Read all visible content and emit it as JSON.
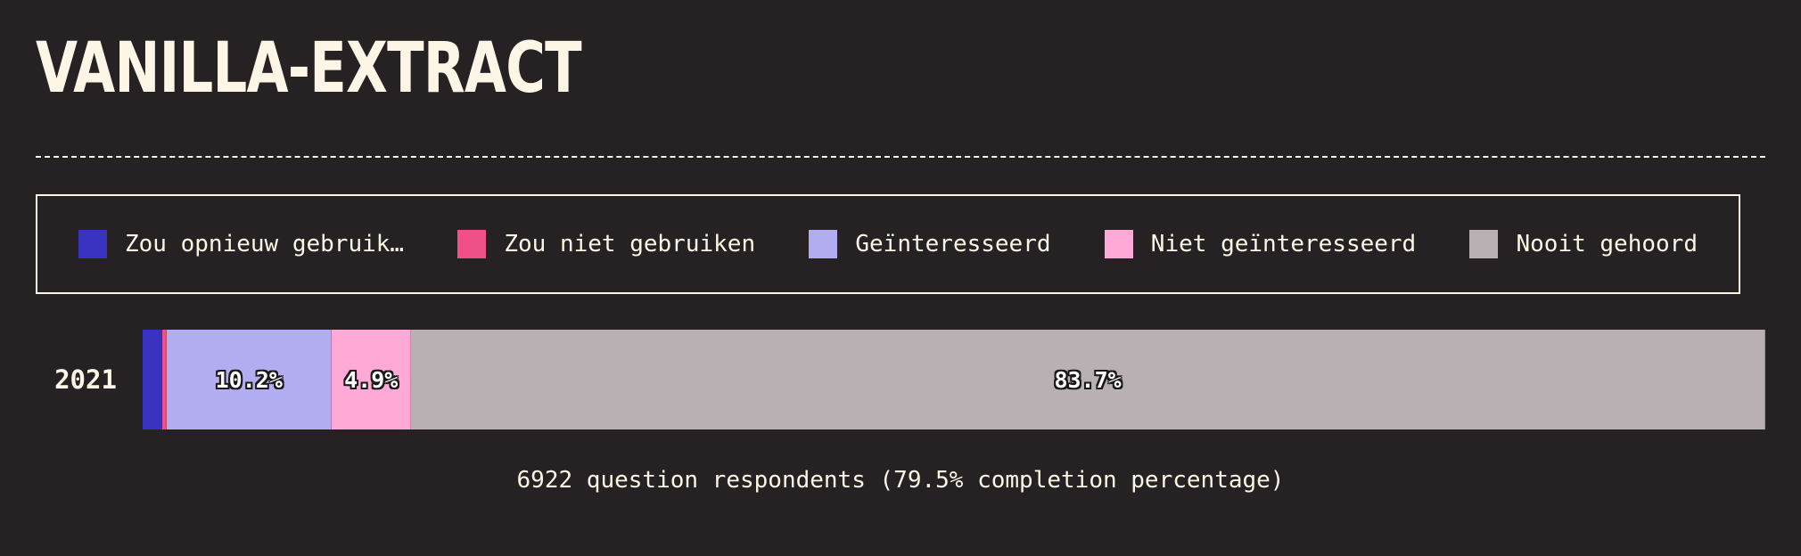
{
  "title": "VANILLA-EXTRACT",
  "legend": [
    {
      "label": "Zou opnieuw gebruik…",
      "color": "#3a33c2"
    },
    {
      "label": "Zou niet gebruiken",
      "color": "#f0508a"
    },
    {
      "label": "Geïnteresseerd",
      "color": "#b2adf0"
    },
    {
      "label": "Niet geïnteresseerd",
      "color": "#ffaad6"
    },
    {
      "label": "Nooit gehoord",
      "color": "#b9b0b4"
    }
  ],
  "chart_data": {
    "type": "bar",
    "orientation": "horizontal-stacked-100",
    "categories": [
      "2021"
    ],
    "series": [
      {
        "name": "Zou opnieuw gebruik…",
        "values": [
          1.2
        ],
        "color": "#3a33c2"
      },
      {
        "name": "Zou niet gebruiken",
        "values": [
          0.3
        ],
        "color": "#f0508a"
      },
      {
        "name": "Geïnteresseerd",
        "values": [
          10.2
        ],
        "color": "#b2adf0",
        "label": "10.2%"
      },
      {
        "name": "Niet geïnteresseerd",
        "values": [
          4.9
        ],
        "color": "#ffaad6",
        "label": "4.9%"
      },
      {
        "name": "Nooit gehoord",
        "values": [
          83.7
        ],
        "color": "#b9b0b4",
        "label": "83.7%"
      }
    ],
    "xlim": [
      0,
      100
    ]
  },
  "footnote": "6922 question respondents (79.5% completion percentage)"
}
